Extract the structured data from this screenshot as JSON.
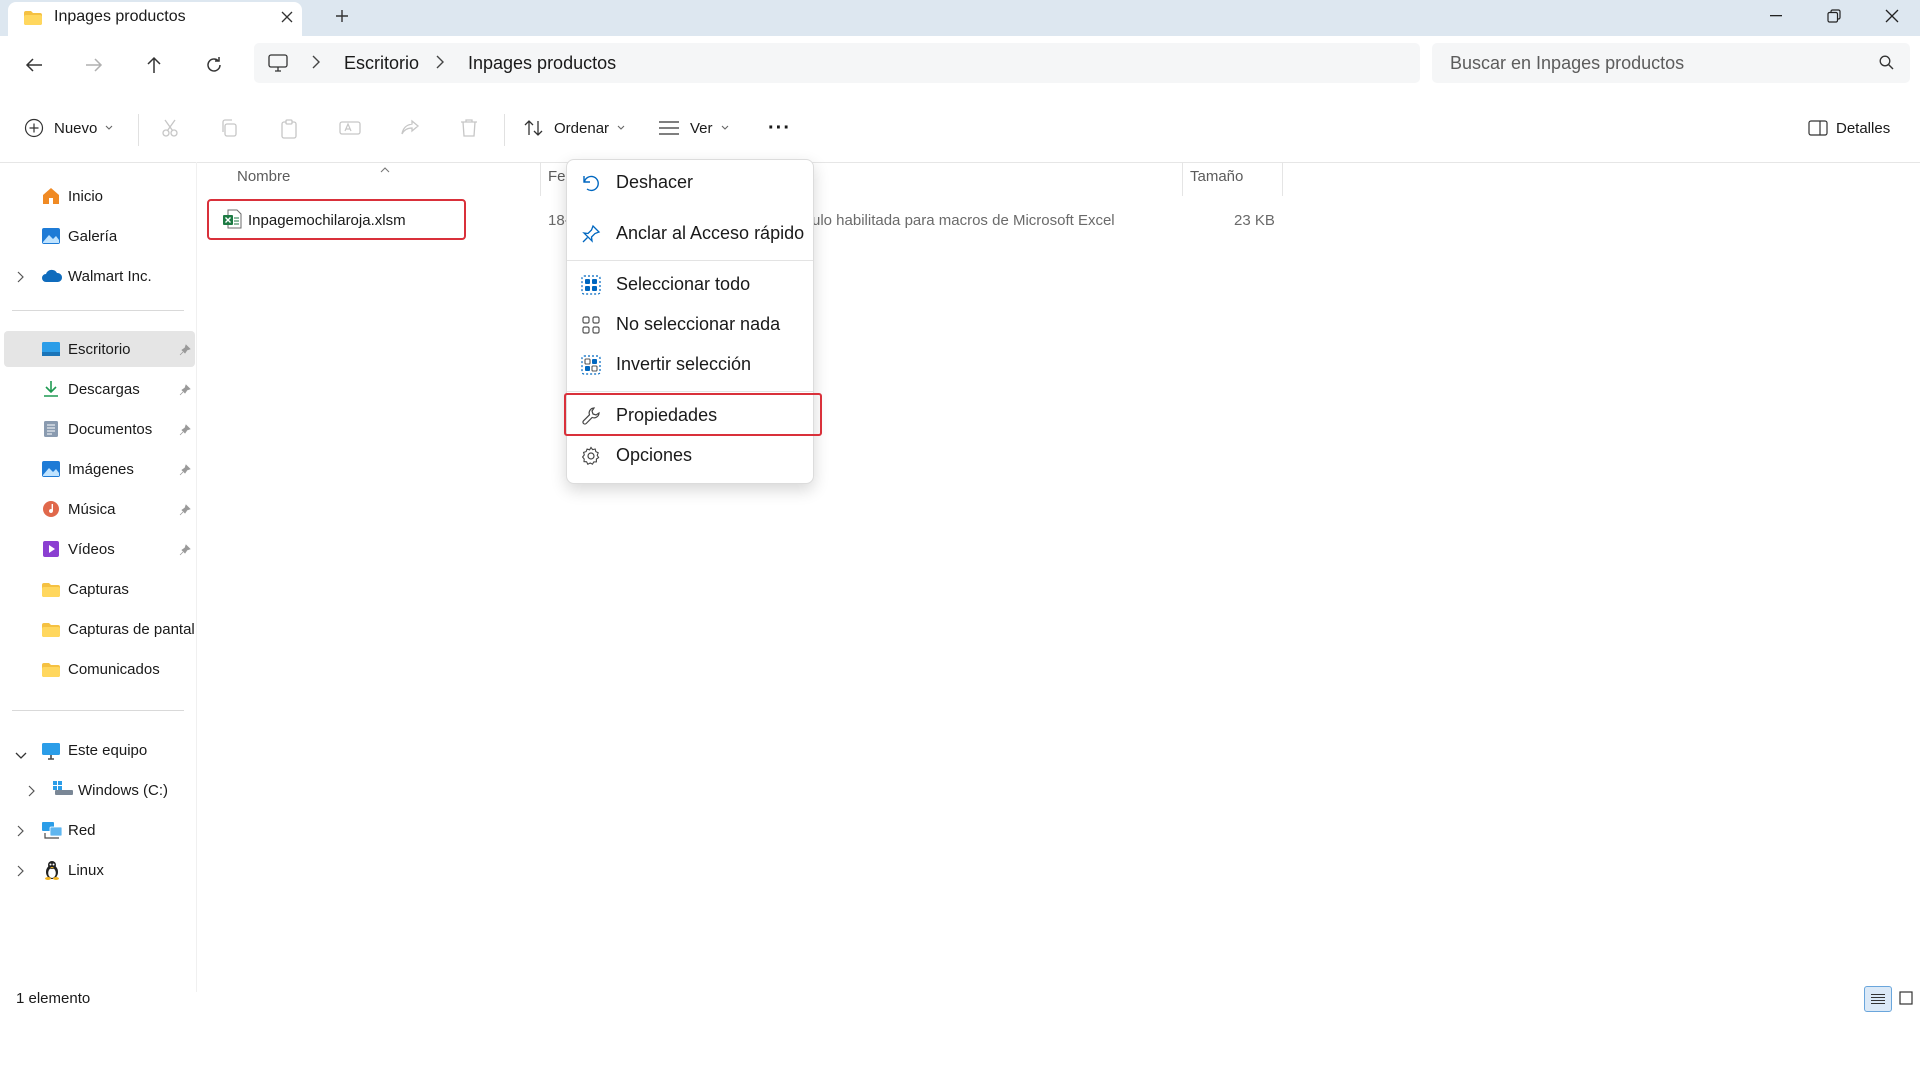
{
  "tab": {
    "title": "Inpages productos"
  },
  "address": {
    "crumbs": [
      "Escritorio",
      "Inpages productos"
    ]
  },
  "search": {
    "placeholder": "Buscar en Inpages productos"
  },
  "commandbar": {
    "new_label": "Nuevo",
    "sort_label": "Ordenar",
    "view_label": "Ver",
    "more_label": "···",
    "details_label": "Detalles"
  },
  "sidebar": {
    "quick": [
      {
        "label": "Inicio",
        "icon": "home-icon"
      },
      {
        "label": "Galería",
        "icon": "gallery-icon"
      },
      {
        "label": "Walmart Inc.",
        "icon": "cloud-icon"
      }
    ],
    "pinned": [
      {
        "label": "Escritorio",
        "icon": "desktop-icon"
      },
      {
        "label": "Descargas",
        "icon": "download-icon"
      },
      {
        "label": "Documentos",
        "icon": "document-icon"
      },
      {
        "label": "Imágenes",
        "icon": "pictures-icon"
      },
      {
        "label": "Música",
        "icon": "music-icon"
      },
      {
        "label": "Vídeos",
        "icon": "video-icon"
      },
      {
        "label": "Capturas",
        "icon": "folder-icon"
      },
      {
        "label": "Capturas de pantall",
        "icon": "folder-icon"
      },
      {
        "label": "Comunicados",
        "icon": "folder-icon"
      }
    ],
    "devices": [
      {
        "label": "Este equipo",
        "icon": "computer-icon"
      },
      {
        "label": "Windows (C:)",
        "icon": "drive-icon"
      },
      {
        "label": "Red",
        "icon": "network-icon"
      },
      {
        "label": "Linux",
        "icon": "linux-icon"
      }
    ]
  },
  "filelist": {
    "columns": {
      "name": "Nombre",
      "date": "Fec",
      "size": "Tamaño"
    },
    "rows": [
      {
        "name": "Inpagemochilaroja.xlsm",
        "date": "18-",
        "type": "ulo habilitada para macros de Microsoft Excel",
        "size": "23 KB"
      }
    ]
  },
  "context_menu": {
    "items": [
      {
        "label": "Deshacer",
        "icon": "undo-icon"
      },
      {
        "label": "Anclar al Acceso rápido",
        "icon": "pin-icon"
      },
      {
        "label": "Seleccionar todo",
        "icon": "select-all-icon"
      },
      {
        "label": "No seleccionar nada",
        "icon": "select-none-icon"
      },
      {
        "label": "Invertir selección",
        "icon": "invert-selection-icon"
      },
      {
        "label": "Propiedades",
        "icon": "wrench-icon"
      },
      {
        "label": "Opciones",
        "icon": "gear-icon"
      }
    ]
  },
  "status": {
    "count": "1 elemento"
  },
  "colors": {
    "highlight": "#d9303a",
    "titlebar": "#dde7f0",
    "accent": "#0067c0"
  }
}
